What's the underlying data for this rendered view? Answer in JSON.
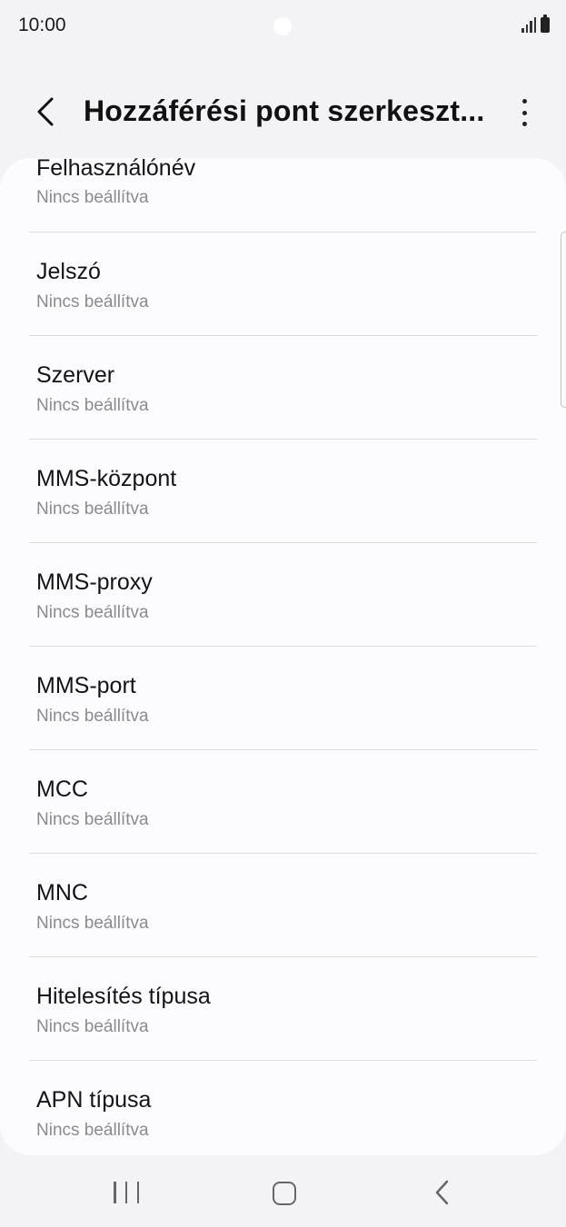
{
  "status_bar": {
    "time": "10:00",
    "icons": [
      "camera-cutout",
      "signal-icon",
      "battery-icon"
    ]
  },
  "app_bar": {
    "back_icon": "chevron-left-icon",
    "title": "Hozzáférési pont szerkeszt...",
    "more_icon": "more-vertical-icon"
  },
  "settings": {
    "items": [
      {
        "title": "Felhasználónév",
        "value": "Nincs beállítva"
      },
      {
        "title": "Jelszó",
        "value": "Nincs beállítva"
      },
      {
        "title": "Szerver",
        "value": "Nincs beállítva"
      },
      {
        "title": "MMS-központ",
        "value": "Nincs beállítva"
      },
      {
        "title": "MMS-proxy",
        "value": "Nincs beállítva"
      },
      {
        "title": "MMS-port",
        "value": "Nincs beállítva"
      },
      {
        "title": "MCC",
        "value": "Nincs beállítva"
      },
      {
        "title": "MNC",
        "value": "Nincs beállítva"
      },
      {
        "title": "Hitelesítés típusa",
        "value": "Nincs beállítva"
      },
      {
        "title": "APN típusa",
        "value": "Nincs beállítva"
      }
    ]
  },
  "nav_bar": {
    "icons": [
      "recents-icon",
      "home-icon",
      "back-icon"
    ]
  },
  "colors": {
    "background": "#f3f3f6",
    "card": "#fcfcff",
    "title_text": "#141414",
    "secondary_text": "#8a8a8f",
    "divider": "#dcdce0"
  }
}
